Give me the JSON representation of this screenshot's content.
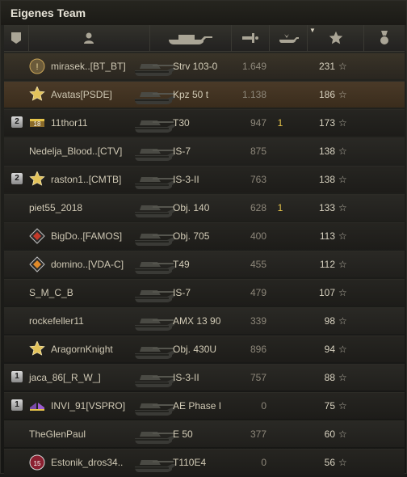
{
  "title": "Eigenes Team",
  "header": {
    "icons": [
      "squad-icon",
      "player-icon",
      "tank-icon",
      "damage-icon",
      "kills-icon",
      "star-icon",
      "medal-icon"
    ]
  },
  "rows": [
    {
      "squad": "",
      "badge": "crown-medal",
      "player": "mirasek..[BT_BT]",
      "tank": "Strv 103-0",
      "damage": "1.649",
      "kills": "",
      "xp": "231",
      "style": "self"
    },
    {
      "squad": "",
      "badge": "gold-star",
      "player": "Avatas[PSDE]",
      "tank": "Kpz 50 t",
      "damage": "1.138",
      "kills": "",
      "xp": "186",
      "style": "highlight"
    },
    {
      "squad": "2",
      "badge": "number-18",
      "player": "11thor11",
      "tank": "T30",
      "damage": "947",
      "kills": "1",
      "xp": "173",
      "style": ""
    },
    {
      "squad": "",
      "badge": "",
      "player": "Nedelja_Blood..[CTV]",
      "tank": "IS-7",
      "damage": "875",
      "kills": "",
      "xp": "138",
      "style": "alt"
    },
    {
      "squad": "2",
      "badge": "gold-star",
      "player": "raston1..[CMTB]",
      "tank": "IS-3-II",
      "damage": "763",
      "kills": "",
      "xp": "138",
      "style": ""
    },
    {
      "squad": "",
      "badge": "",
      "player": "piet55_2018",
      "tank": "Obj. 140",
      "damage": "628",
      "kills": "1",
      "xp": "133",
      "style": "alt"
    },
    {
      "squad": "",
      "badge": "red-diamond",
      "player": "BigDo..[FAMOS]",
      "tank": "Obj. 705",
      "damage": "400",
      "kills": "",
      "xp": "113",
      "style": ""
    },
    {
      "squad": "",
      "badge": "orange-diamond",
      "player": "domino..[VDA-C]",
      "tank": "T49",
      "damage": "455",
      "kills": "",
      "xp": "112",
      "style": "alt"
    },
    {
      "squad": "",
      "badge": "",
      "player": "S_M_C_B",
      "tank": "IS-7",
      "damage": "479",
      "kills": "",
      "xp": "107",
      "style": ""
    },
    {
      "squad": "",
      "badge": "",
      "player": "rockefeller11",
      "tank": "AMX 13 90",
      "damage": "339",
      "kills": "",
      "xp": "98",
      "style": "alt"
    },
    {
      "squad": "",
      "badge": "gold-star",
      "player": "AragornKnight",
      "tank": "Obj. 430U",
      "damage": "896",
      "kills": "",
      "xp": "94",
      "style": ""
    },
    {
      "squad": "1",
      "badge": "",
      "player": "jaca_86[_R_W_]",
      "tank": "IS-3-II",
      "damage": "757",
      "kills": "",
      "xp": "88",
      "style": "alt"
    },
    {
      "squad": "1",
      "badge": "purple-wings",
      "player": "INVI_91[VSPRO]",
      "tank": "AE Phase I",
      "damage": "0",
      "kills": "",
      "xp": "75",
      "style": ""
    },
    {
      "squad": "",
      "badge": "",
      "player": "TheGlenPaul",
      "tank": "E 50",
      "damage": "377",
      "kills": "",
      "xp": "60",
      "style": "alt"
    },
    {
      "squad": "",
      "badge": "number-15",
      "player": "Estonik_dros34..",
      "tank": "T110E4",
      "damage": "0",
      "kills": "",
      "xp": "56",
      "style": ""
    }
  ],
  "colors": {
    "kills": "#e6c44a",
    "damage": "#8d877a",
    "accent": "#d8d2c0"
  }
}
